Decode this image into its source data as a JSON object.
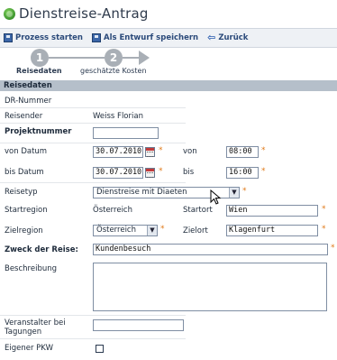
{
  "app": {
    "title": "Dienstreise-Antrag"
  },
  "toolbar": {
    "start_label": "Prozess starten",
    "draft_label": "Als Entwurf speichern",
    "back_label": "Zurück"
  },
  "steps": [
    {
      "number": "1",
      "label": "Reisedaten"
    },
    {
      "number": "2",
      "label": "geschätzte Kosten"
    }
  ],
  "section": {
    "title": "Reisedaten"
  },
  "form": {
    "dr_number_label": "DR-Nummer",
    "traveler_label": "Reisender",
    "traveler_value": "Weiss Florian",
    "project_label": "Projektnummer",
    "project_value": "",
    "from_date_label": "von Datum",
    "from_date_value": "30.07.2010",
    "from_time_label": "von",
    "from_time_value": "08:00",
    "to_date_label": "bis Datum",
    "to_date_value": "30.07.2010",
    "to_time_label": "bis",
    "to_time_value": "16:00",
    "travel_type_label": "Reisetyp",
    "travel_type_value": "Dienstreise mit Diaeten",
    "start_region_label": "Startregion",
    "start_region_value": "Österreich",
    "start_place_label": "Startort",
    "start_place_value": "Wien",
    "target_region_label": "Zielregion",
    "target_region_value": "Österreich",
    "target_place_label": "Zielort",
    "target_place_value": "Klagenfurt",
    "purpose_label": "Zweck der Reise:",
    "purpose_value": "Kundenbesuch",
    "description_label": "Beschreibung",
    "organizer_label": "Veranstalter bei Tagungen",
    "organizer_value": "",
    "own_car_label": "Eigener PKW",
    "required_mark": "*"
  },
  "colors": {
    "accent": "#e07a1a",
    "section_bg": "#b5bfca",
    "step_gray": "#a9afb6"
  }
}
